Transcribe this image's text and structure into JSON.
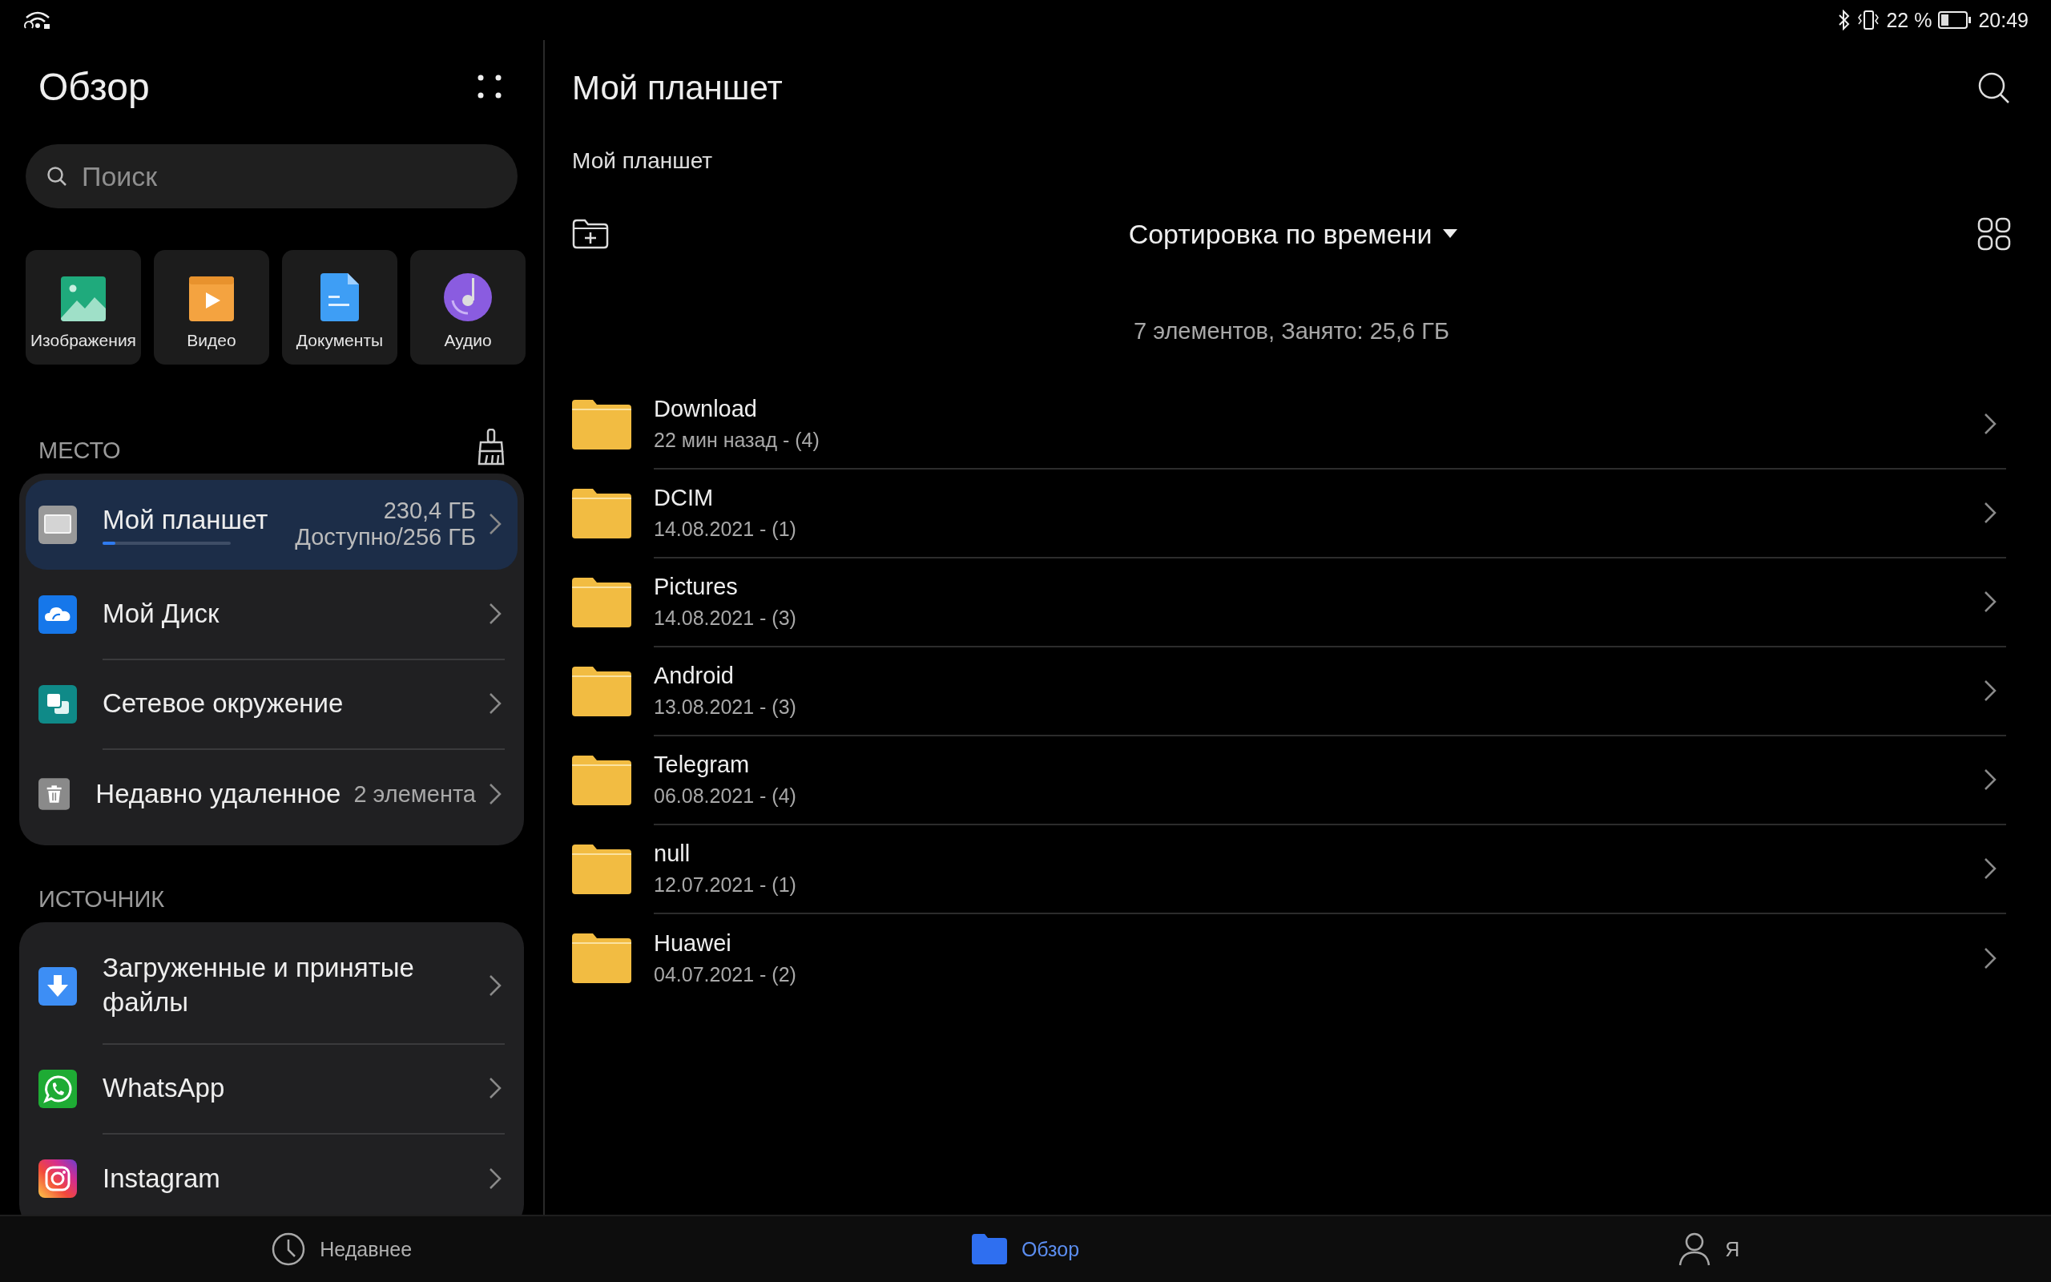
{
  "status_bar": {
    "battery": "22 %",
    "time": "20:49"
  },
  "sidebar": {
    "title": "Обзор",
    "search": {
      "placeholder": "Поиск"
    },
    "categories": [
      {
        "label": "Изображения",
        "kind": "images"
      },
      {
        "label": "Видео",
        "kind": "video"
      },
      {
        "label": "Документы",
        "kind": "docs"
      },
      {
        "label": "Аудио",
        "kind": "audio"
      }
    ],
    "storage": {
      "heading": "МЕСТО",
      "items": [
        {
          "label": "Мой планшет",
          "kind": "tablet",
          "selected": true,
          "size": "230,4 ГБ",
          "available": "Доступно/256 ГБ",
          "level": 0.1
        },
        {
          "label": "Мой Диск",
          "kind": "cloud",
          "selected": false
        },
        {
          "label": "Сетевое окружение",
          "kind": "network",
          "selected": false
        },
        {
          "label": "Недавно удаленное",
          "kind": "trash",
          "selected": false,
          "count": "2 элемента"
        }
      ]
    },
    "sources": {
      "heading": "ИСТОЧНИК",
      "items": [
        {
          "label": "Загруженные и принятые файлы",
          "kind": "download"
        },
        {
          "label": "WhatsApp",
          "kind": "chat"
        },
        {
          "label": "Instagram",
          "kind": "camera"
        }
      ]
    }
  },
  "main": {
    "title": "Мой планшет",
    "breadcrumb": "Мой планшет",
    "sort": "Сортировка по времени",
    "summary": "7 элементов, Занято: 25,6 ГБ",
    "folders": [
      {
        "name": "Download",
        "meta": "22 мин назад - (4)"
      },
      {
        "name": "DCIM",
        "meta": "14.08.2021 - (1)"
      },
      {
        "name": "Pictures",
        "meta": "14.08.2021 - (3)"
      },
      {
        "name": "Android",
        "meta": "13.08.2021 - (3)"
      },
      {
        "name": "Telegram",
        "meta": "06.08.2021 - (4)"
      },
      {
        "name": "null",
        "meta": "12.07.2021 - (1)"
      },
      {
        "name": "Huawei",
        "meta": "04.07.2021 - (2)"
      }
    ]
  },
  "bottom_nav": [
    {
      "label": "Недавнее",
      "kind": "clock",
      "selected": false
    },
    {
      "label": "Обзор",
      "kind": "folder",
      "selected": true
    },
    {
      "label": "Я",
      "kind": "person",
      "selected": false
    }
  ]
}
